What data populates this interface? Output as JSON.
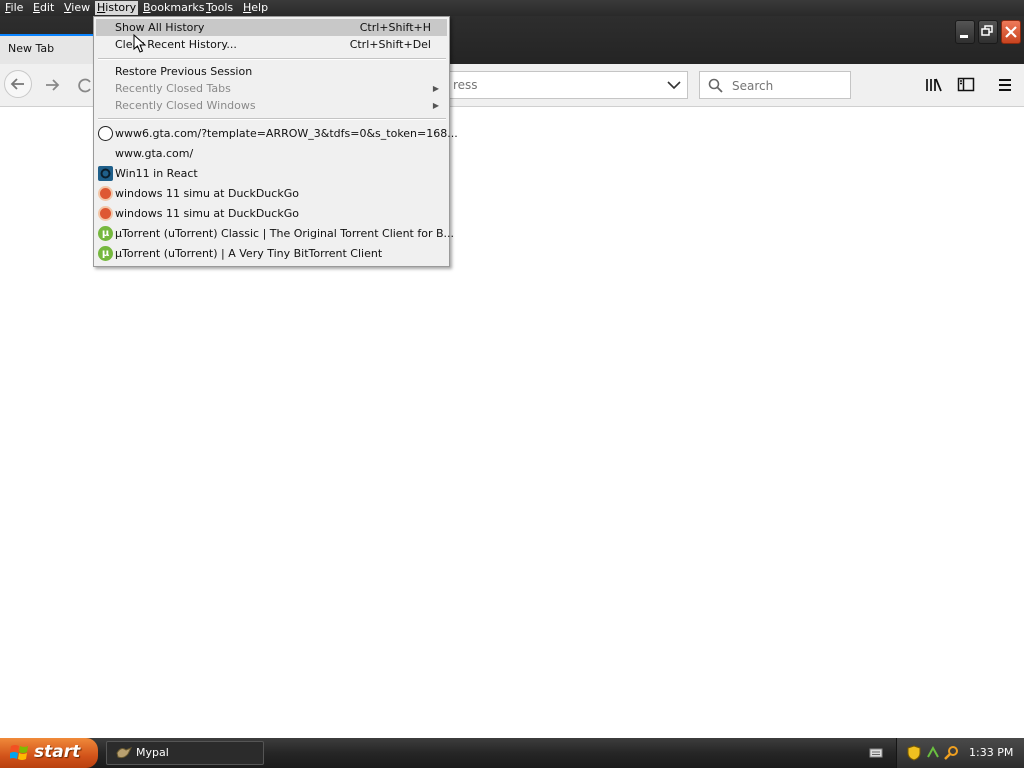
{
  "menubar": {
    "items": [
      {
        "label": "File",
        "accel": "F",
        "rest": "ile"
      },
      {
        "label": "Edit",
        "accel": "E",
        "rest": "dit"
      },
      {
        "label": "View",
        "accel": "V",
        "rest": "iew"
      },
      {
        "label": "History",
        "accel": "H",
        "rest": "istory"
      },
      {
        "label": "Bookmarks",
        "accel": "B",
        "rest": "ookmarks"
      },
      {
        "label": "Tools",
        "accel": "T",
        "rest": "ools"
      },
      {
        "label": "Help",
        "accel": "H",
        "rest": "elp"
      }
    ]
  },
  "tabs": [
    {
      "label": "New Tab"
    }
  ],
  "toolbar": {
    "url_placeholder": "ress",
    "search_placeholder": "Search"
  },
  "history_menu": {
    "show_all": {
      "label": "Show All History",
      "shortcut": "Ctrl+Shift+H"
    },
    "clear_recent": {
      "label": "Clear Recent History...",
      "shortcut": "Ctrl+Shift+Del"
    },
    "restore": {
      "label": "Restore Previous Session"
    },
    "closed_tabs": {
      "label": "Recently Closed Tabs"
    },
    "closed_windows": {
      "label": "Recently Closed Windows"
    },
    "entries": [
      {
        "label": "www6.gta.com/?template=ARROW_3&tdfs=0&s_token=168...",
        "icon": "globe-icon"
      },
      {
        "label": "www.gta.com/",
        "icon": "none"
      },
      {
        "label": "Win11 in React",
        "icon": "react-icon"
      },
      {
        "label": "windows 11 simu at DuckDuckGo",
        "icon": "duckduckgo-icon"
      },
      {
        "label": "windows 11 simu at DuckDuckGo",
        "icon": "duckduckgo-icon"
      },
      {
        "label": "µTorrent (uTorrent) Classic | The Original Torrent Client for B...",
        "icon": "utorrent-icon"
      },
      {
        "label": "µTorrent (uTorrent) | A Very Tiny BitTorrent Client",
        "icon": "utorrent-icon"
      }
    ]
  },
  "taskbar": {
    "start_label": "start",
    "task_label": "Mypal",
    "clock": "1:33 PM"
  },
  "colors": {
    "accent": "#0a84ff",
    "start_orange": "#d2531a",
    "menu_highlight": "#c8c8c8"
  }
}
